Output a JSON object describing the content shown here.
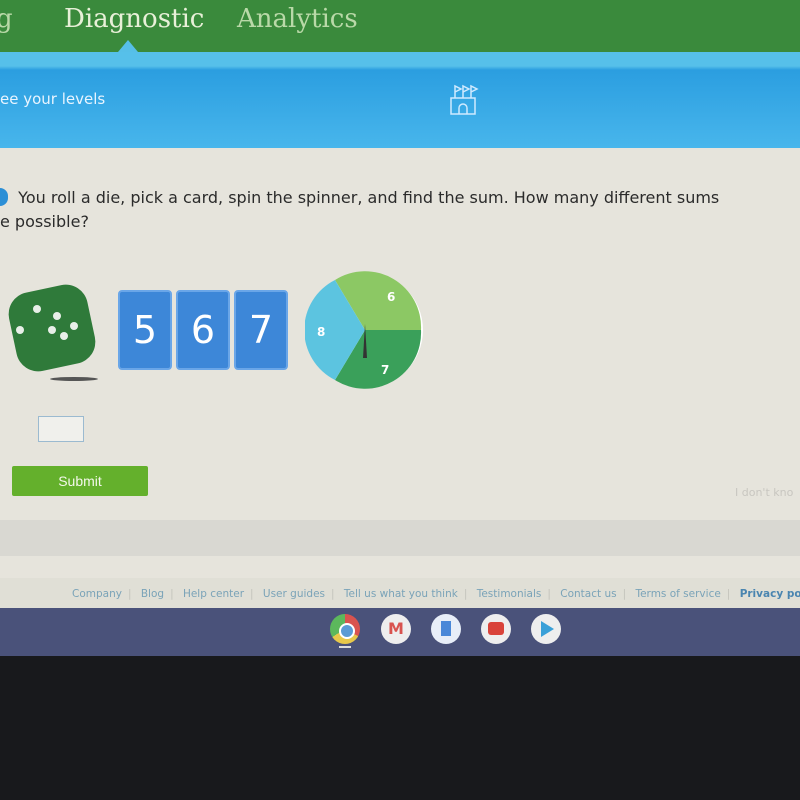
{
  "nav": {
    "tabs": [
      {
        "label": "g"
      },
      {
        "label": "Diagnostic",
        "active": true
      },
      {
        "label": "Analytics"
      }
    ]
  },
  "banner": {
    "text": "ee your levels",
    "icon": "castle-icon"
  },
  "question": {
    "text": "You roll a die, pick a card, spin the spinner, and find the sum. How many different sums",
    "text2": "e possible?"
  },
  "cards": [
    "5",
    "6",
    "7"
  ],
  "spinner": {
    "sections": [
      "6",
      "7",
      "8"
    ],
    "colors": [
      "#8cc864",
      "#3aa05a",
      "#5cc4e0"
    ]
  },
  "answer": {
    "value": ""
  },
  "submit_label": "Submit",
  "dont_know": "I don't kno",
  "footer": {
    "links": [
      "Company",
      "Blog",
      "Help center",
      "User guides",
      "Tell us what you think",
      "Testimonials",
      "Contact us",
      "Terms of service"
    ],
    "privacy": "Privacy policy"
  },
  "shelf": {
    "apps": [
      "chrome-icon",
      "gmail-icon",
      "docs-icon",
      "youtube-icon",
      "play-store-icon"
    ]
  },
  "colors": {
    "nav": "#3a8a3c",
    "banner": "#2b9ee0",
    "submit": "#64b02c"
  }
}
